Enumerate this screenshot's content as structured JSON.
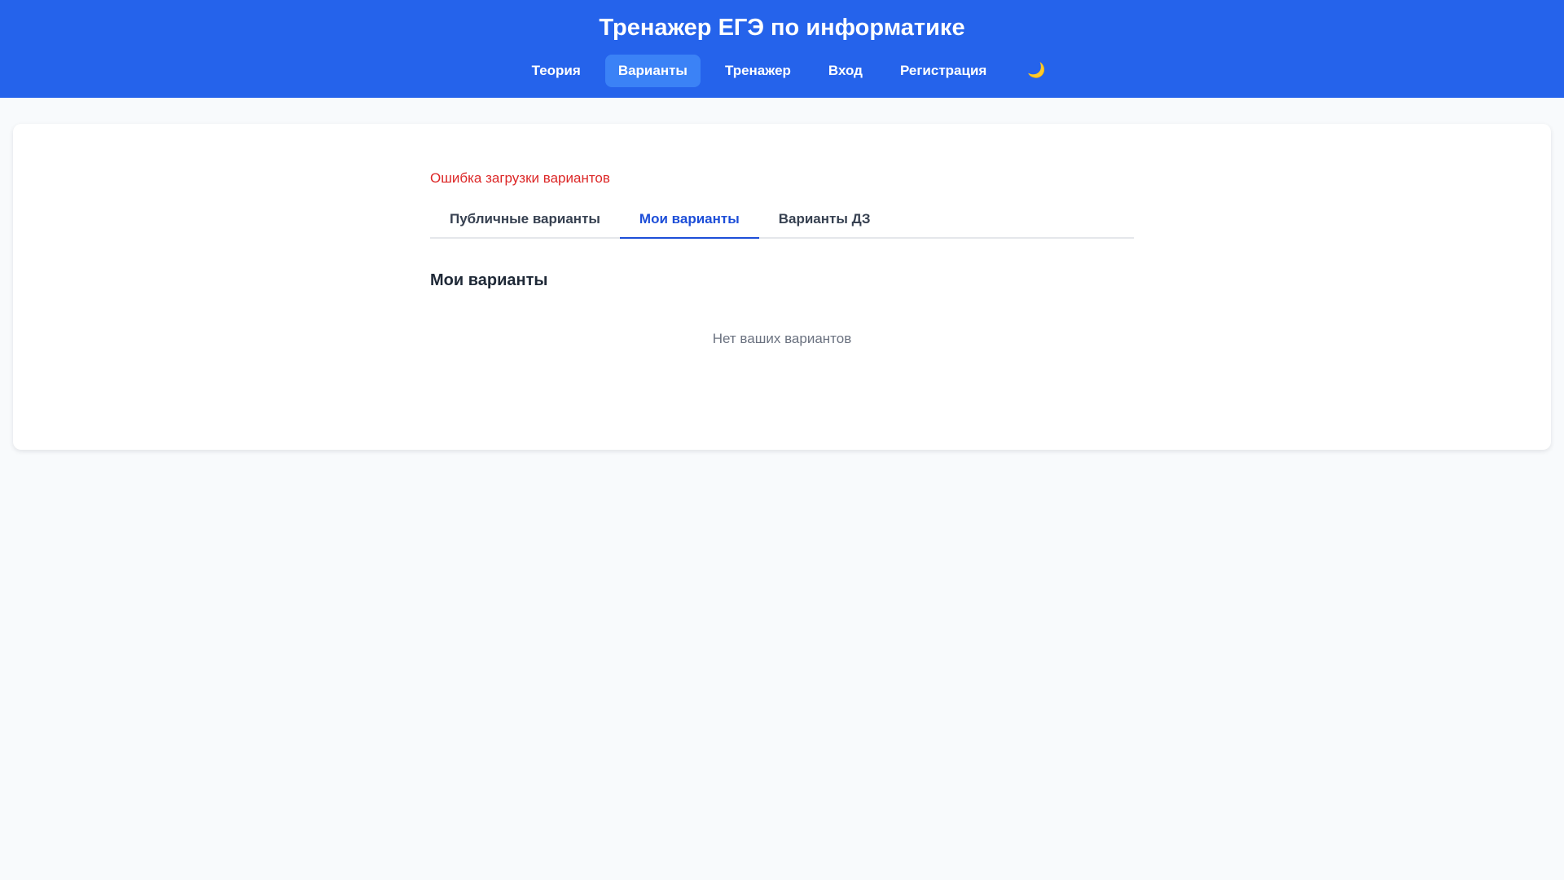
{
  "header": {
    "title": "Тренажер ЕГЭ по информатике",
    "nav": [
      {
        "label": "Теория",
        "active": false
      },
      {
        "label": "Варианты",
        "active": true
      },
      {
        "label": "Тренажер",
        "active": false
      },
      {
        "label": "Вход",
        "active": false
      },
      {
        "label": "Регистрация",
        "active": false
      }
    ],
    "theme_toggle_icon": "moon-icon",
    "theme_toggle_glyph": "🌙"
  },
  "main": {
    "error": "Ошибка загрузки вариантов",
    "tabs": [
      {
        "label": "Публичные варианты",
        "active": false
      },
      {
        "label": "Мои варианты",
        "active": true
      },
      {
        "label": "Варианты ДЗ",
        "active": false
      }
    ],
    "section_title": "Мои варианты",
    "empty_message": "Нет ваших вариантов"
  },
  "colors": {
    "header_bg": "#2563eb",
    "active_nav_bg": "#3b82f6",
    "error": "#dc2626",
    "active_tab": "#1d4ed8",
    "page_bg": "#f8fafc"
  }
}
